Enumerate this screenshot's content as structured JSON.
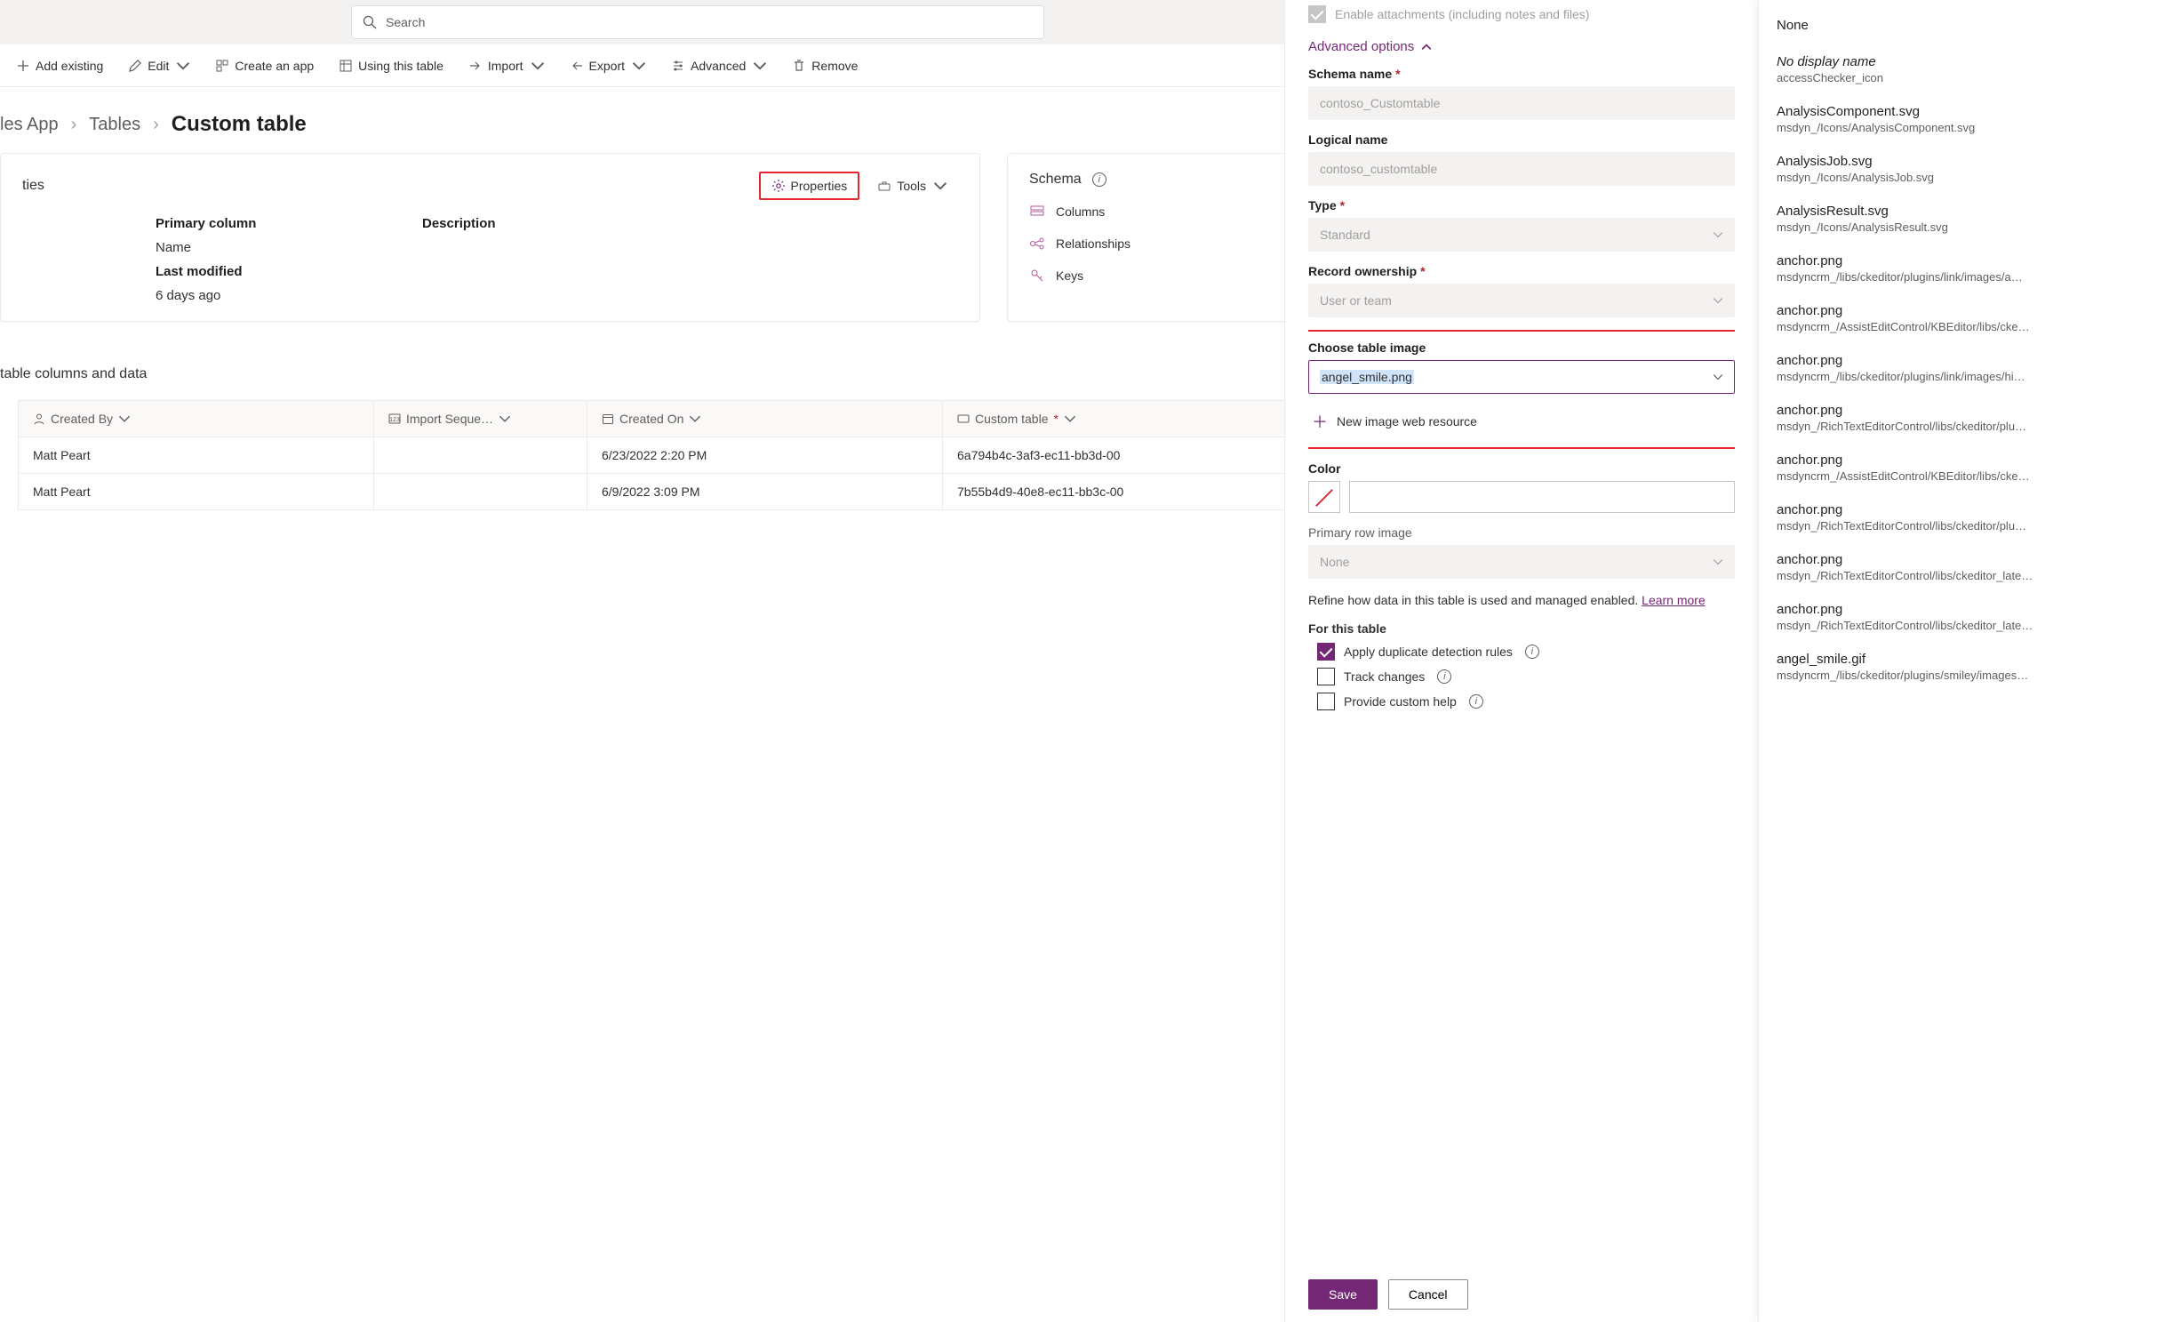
{
  "header": {
    "search_placeholder": "Search"
  },
  "commands": {
    "add_existing": "Add existing",
    "edit": "Edit",
    "create_app": "Create an app",
    "using_table": "Using this table",
    "import": "Import",
    "export": "Export",
    "advanced": "Advanced",
    "remove": "Remove"
  },
  "breadcrumb": {
    "app": "les App",
    "tables": "Tables",
    "current": "Custom table"
  },
  "details_card": {
    "title": "ties",
    "properties_btn": "Properties",
    "tools_btn": "Tools",
    "primary_col_label": "Primary column",
    "primary_col_val": "Name",
    "desc_label": "Description",
    "last_mod_label": "Last modified",
    "last_mod_val": "6 days ago"
  },
  "schema_card": {
    "title": "Schema",
    "columns": "Columns",
    "relationships": "Relationships",
    "keys": "Keys"
  },
  "data_section": {
    "title": "table columns and data",
    "cols": {
      "created_by": "Created By",
      "import_seq": "Import Seque…",
      "created_on": "Created On",
      "custom_table": "Custom table"
    },
    "rows": [
      {
        "created_by": "Matt Peart",
        "import_seq": "",
        "created_on": "6/23/2022 2:20 PM",
        "custom_table": "6a794b4c-3af3-ec11-bb3d-00"
      },
      {
        "created_by": "Matt Peart",
        "import_seq": "",
        "created_on": "6/9/2022 3:09 PM",
        "custom_table": "7b55b4d9-40e8-ec11-bb3c-00"
      }
    ]
  },
  "pane": {
    "enable_attachments": "Enable attachments (including notes and files)",
    "advanced_options": "Advanced options",
    "schema_name_label": "Schema name",
    "schema_name_val": "contoso_Customtable",
    "logical_name_label": "Logical name",
    "logical_name_val": "contoso_customtable",
    "type_label": "Type",
    "type_val": "Standard",
    "record_ownership_label": "Record ownership",
    "record_ownership_val": "User or team",
    "choose_image_label": "Choose table image",
    "choose_image_val": "angel_smile.png",
    "new_resource": "New image web resource",
    "color_label": "Color",
    "primary_row_label": "Primary row image",
    "primary_row_val": "None",
    "refine_text": "Refine how data in this table is used and managed enabled. ",
    "learn_more": "Learn more",
    "for_this_table": "For this table",
    "apply_dup": "Apply duplicate detection rules",
    "track_changes": "Track changes",
    "custom_help": "Provide custom help",
    "save": "Save",
    "cancel": "Cancel"
  },
  "options": [
    {
      "title": "None",
      "sub": ""
    },
    {
      "title": "No display name",
      "sub": "accessChecker_icon",
      "italic": true
    },
    {
      "title": "AnalysisComponent.svg",
      "sub": "msdyn_/Icons/AnalysisComponent.svg"
    },
    {
      "title": "AnalysisJob.svg",
      "sub": "msdyn_/Icons/AnalysisJob.svg"
    },
    {
      "title": "AnalysisResult.svg",
      "sub": "msdyn_/Icons/AnalysisResult.svg"
    },
    {
      "title": "anchor.png",
      "sub": "msdyncrm_/libs/ckeditor/plugins/link/images/a…"
    },
    {
      "title": "anchor.png",
      "sub": "msdyncrm_/AssistEditControl/KBEditor/libs/cke…"
    },
    {
      "title": "anchor.png",
      "sub": "msdyncrm_/libs/ckeditor/plugins/link/images/hi…"
    },
    {
      "title": "anchor.png",
      "sub": "msdyn_/RichTextEditorControl/libs/ckeditor/plu…"
    },
    {
      "title": "anchor.png",
      "sub": "msdyncrm_/AssistEditControl/KBEditor/libs/cke…"
    },
    {
      "title": "anchor.png",
      "sub": "msdyn_/RichTextEditorControl/libs/ckeditor/plu…"
    },
    {
      "title": "anchor.png",
      "sub": "msdyn_/RichTextEditorControl/libs/ckeditor_late…"
    },
    {
      "title": "anchor.png",
      "sub": "msdyn_/RichTextEditorControl/libs/ckeditor_late…"
    },
    {
      "title": "angel_smile.gif",
      "sub": "msdyncrm_/libs/ckeditor/plugins/smiley/images…"
    }
  ]
}
